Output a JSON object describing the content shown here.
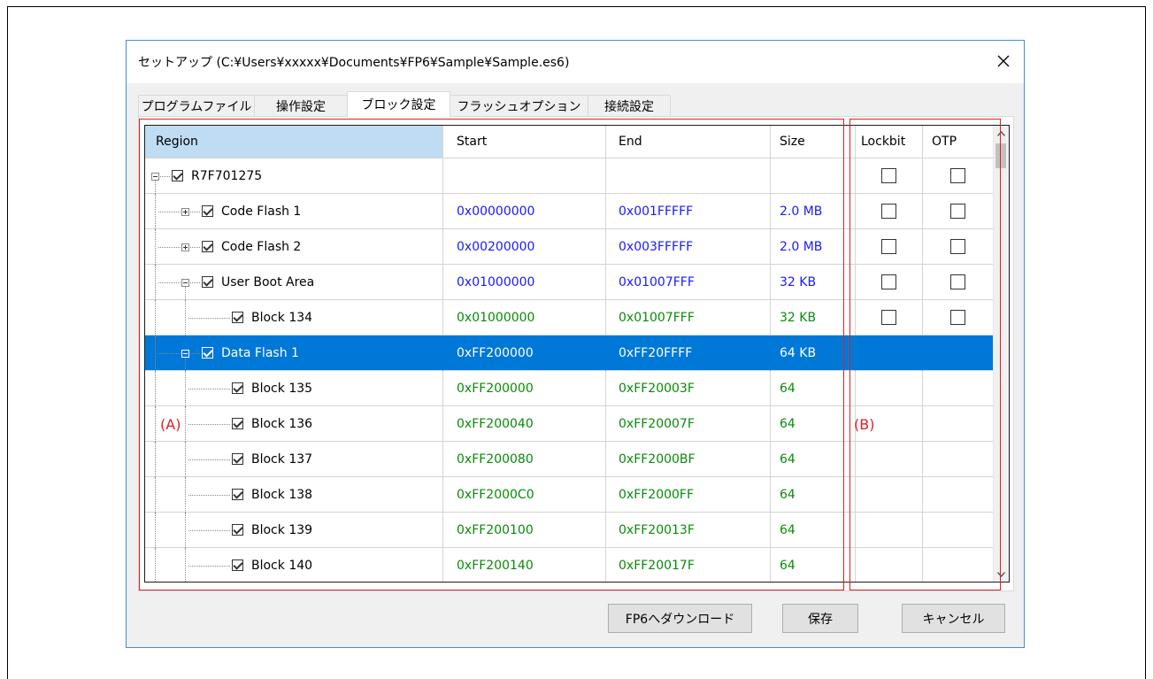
{
  "window": {
    "title": "セットアップ (C:¥Users¥xxxxx¥Documents¥FP6¥Sample¥Sample.es6)"
  },
  "tabs": [
    "プログラムファイル",
    "操作設定",
    "ブロック設定",
    "フラッシュオプション",
    "接続設定"
  ],
  "active_tab": "ブロック設定",
  "table": {
    "columns": [
      "Region",
      "Start",
      "End",
      "Size",
      "Lockbit",
      "OTP"
    ],
    "rows": [
      {
        "level": 0,
        "expander": "minus",
        "label": "R7F701275",
        "start": "",
        "end": "",
        "size": "",
        "color": "black",
        "lock": true
      },
      {
        "level": 1,
        "expander": "plus",
        "label": "Code Flash 1",
        "start": "0x00000000",
        "end": "0x001FFFFF",
        "size": "2.0 MB",
        "color": "blue",
        "lock": true
      },
      {
        "level": 1,
        "expander": "plus",
        "label": "Code Flash 2",
        "start": "0x00200000",
        "end": "0x003FFFFF",
        "size": "2.0 MB",
        "color": "blue",
        "lock": true
      },
      {
        "level": 1,
        "expander": "minus",
        "label": "User Boot Area",
        "start": "0x01000000",
        "end": "0x01007FFF",
        "size": "32 KB",
        "color": "blue",
        "lock": true
      },
      {
        "level": 2,
        "expander": "",
        "label": "Block 134",
        "start": "0x01000000",
        "end": "0x01007FFF",
        "size": "32 KB",
        "color": "green",
        "lock": true
      },
      {
        "level": 1,
        "expander": "minus",
        "label": "Data Flash 1",
        "start": "0xFF200000",
        "end": "0xFF20FFFF",
        "size": "64 KB",
        "color": "green",
        "lock": false,
        "selected": true
      },
      {
        "level": 2,
        "expander": "",
        "label": "Block 135",
        "start": "0xFF200000",
        "end": "0xFF20003F",
        "size": "64",
        "color": "green",
        "lock": false
      },
      {
        "level": 2,
        "expander": "",
        "label": "Block 136",
        "start": "0xFF200040",
        "end": "0xFF20007F",
        "size": "64",
        "color": "green",
        "lock": false
      },
      {
        "level": 2,
        "expander": "",
        "label": "Block 137",
        "start": "0xFF200080",
        "end": "0xFF2000BF",
        "size": "64",
        "color": "green",
        "lock": false
      },
      {
        "level": 2,
        "expander": "",
        "label": "Block 138",
        "start": "0xFF2000C0",
        "end": "0xFF2000FF",
        "size": "64",
        "color": "green",
        "lock": false
      },
      {
        "level": 2,
        "expander": "",
        "label": "Block 139",
        "start": "0xFF200100",
        "end": "0xFF20013F",
        "size": "64",
        "color": "green",
        "lock": false
      },
      {
        "level": 2,
        "expander": "",
        "label": "Block 140",
        "start": "0xFF200140",
        "end": "0xFF20017F",
        "size": "64",
        "color": "green",
        "lock": false
      }
    ]
  },
  "annotations": {
    "a_label": "(A)",
    "b_label": "(B)",
    "color": "#e02020"
  },
  "buttons": {
    "download": "FP6へダウンロード",
    "save": "保存",
    "cancel": "キャンセル"
  },
  "icons": {
    "close": "close-icon",
    "scroll_up": "chevron-up-icon",
    "scroll_down": "chevron-down-icon"
  },
  "colors": {
    "selection": "#0078d7",
    "header_selected": "#bfdcf3",
    "address_blue": "#1919ff",
    "address_green": "#0a8a0a"
  }
}
